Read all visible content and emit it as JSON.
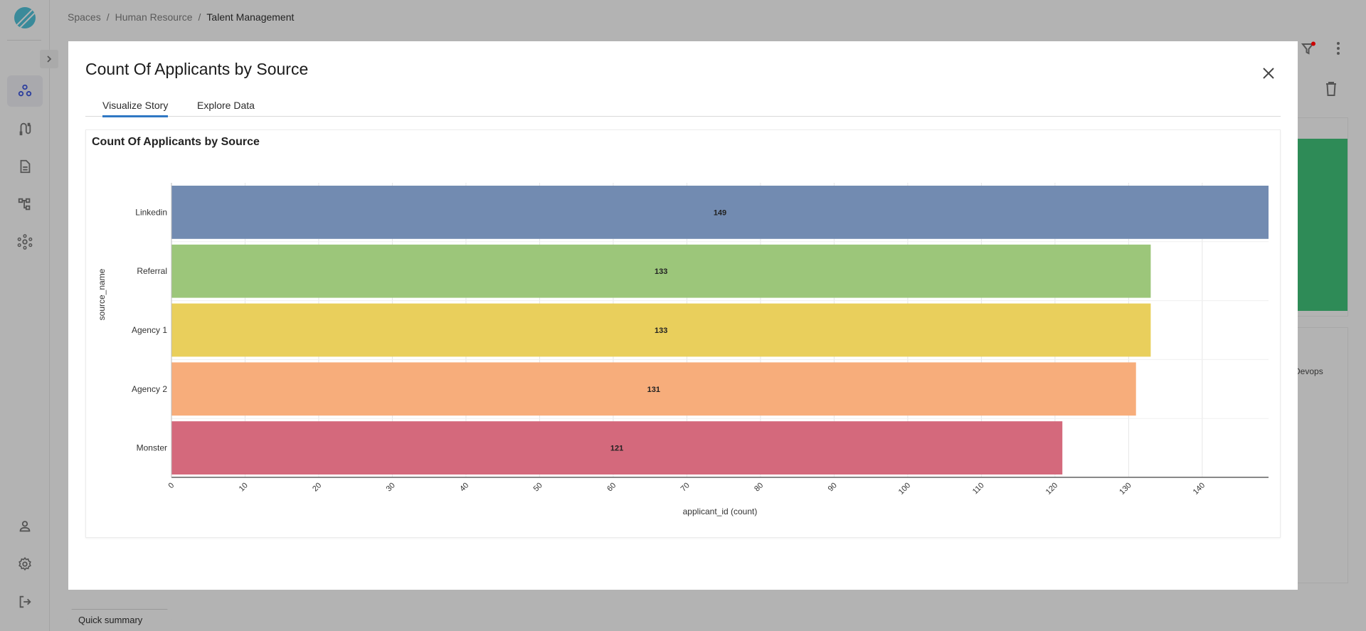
{
  "breadcrumb": [
    "Spaces",
    "Human Resource",
    "Talent Management"
  ],
  "sidebar": {
    "items": [
      {
        "name": "spaces",
        "icon": "nodes-icon",
        "active": true
      },
      {
        "name": "pipelines",
        "icon": "pipeline-icon",
        "active": false
      },
      {
        "name": "documents",
        "icon": "document-icon",
        "active": false
      },
      {
        "name": "hierarchy",
        "icon": "hierarchy-icon",
        "active": false
      },
      {
        "name": "network",
        "icon": "network-icon",
        "active": false
      }
    ],
    "bottom_items": [
      {
        "name": "profile",
        "icon": "user-icon"
      },
      {
        "name": "settings",
        "icon": "gear-icon"
      },
      {
        "name": "logout",
        "icon": "logout-icon"
      }
    ]
  },
  "background": {
    "devops_label": "Devops",
    "quick_summary": "Quick summary",
    "accent_green": "#2e8b57",
    "filter_badge_color": "#cc0000"
  },
  "modal": {
    "title": "Count Of Applicants by Source",
    "tabs": [
      {
        "label": "Visualize Story",
        "active": true
      },
      {
        "label": "Explore Data",
        "active": false
      }
    ],
    "accent": "#2f78c4"
  },
  "chart_data": {
    "type": "bar",
    "orientation": "horizontal",
    "title": "Count Of Applicants by Source",
    "xlabel": "applicant_id (count)",
    "ylabel": "source_name",
    "categories": [
      "Linkedin",
      "Referral",
      "Agency 1",
      "Agency 2",
      "Monster"
    ],
    "values": [
      149,
      133,
      133,
      131,
      121
    ],
    "colors": [
      "#728bb1",
      "#9cc67a",
      "#e9cf5c",
      "#f7ad7b",
      "#d4697c"
    ],
    "data_labels": [
      "149",
      "133",
      "133",
      "131",
      "121"
    ],
    "xlim": [
      0,
      149
    ],
    "xticks": [
      0,
      10,
      20,
      30,
      40,
      50,
      60,
      70,
      80,
      90,
      100,
      110,
      120,
      130,
      140
    ],
    "grid": true,
    "legend": "none"
  }
}
